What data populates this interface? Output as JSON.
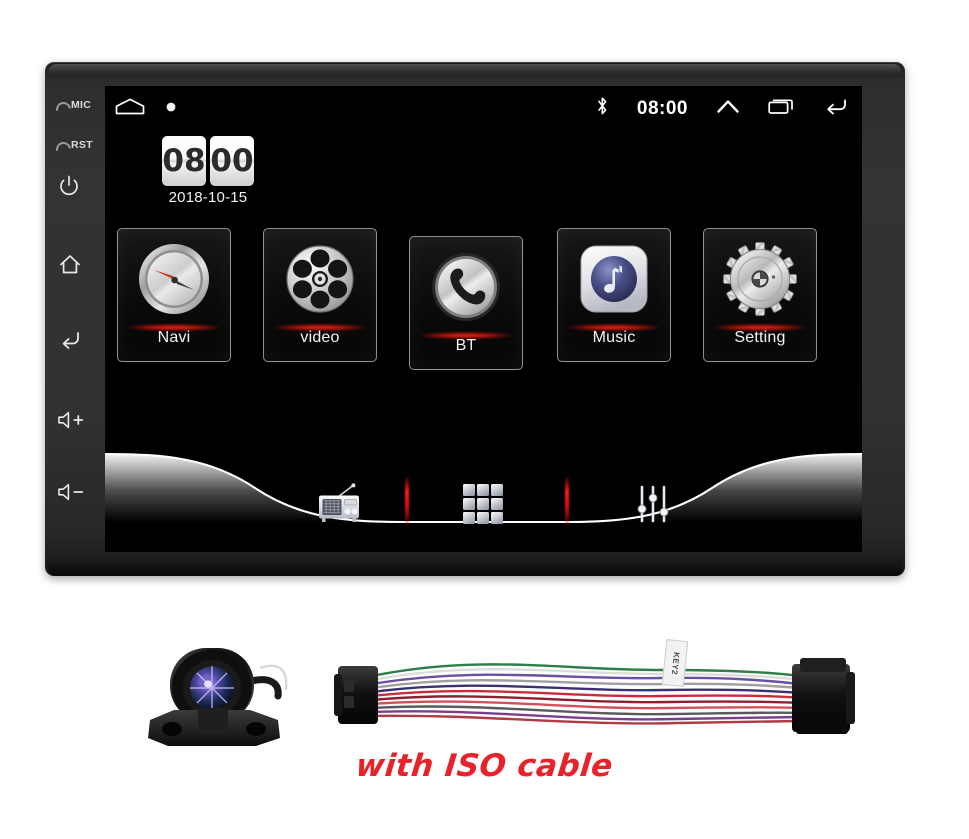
{
  "product": {
    "type": "double-din-android-car-stereo",
    "caption": "with ISO cable",
    "caption_color": "#e8222a"
  },
  "bezel": {
    "indicators": [
      {
        "name": "MIC",
        "label": "MIC"
      },
      {
        "name": "RST",
        "label": "RST"
      }
    ],
    "buttons": [
      {
        "name": "power",
        "icon": "power-icon"
      },
      {
        "name": "home",
        "icon": "home-icon"
      },
      {
        "name": "back",
        "icon": "back-icon"
      },
      {
        "name": "volume-up",
        "icon": "volume-up-icon"
      },
      {
        "name": "volume-down",
        "icon": "volume-down-icon"
      }
    ]
  },
  "statusbar": {
    "home_icon": "home-icon",
    "dot_icon": "dot-indicator-icon",
    "bluetooth_icon": "bluetooth-icon",
    "time": "08:00",
    "chevron_icon": "chevron-up-icon",
    "recents_icon": "recents-icon",
    "back_icon": "back-arrow-icon"
  },
  "clock_widget": {
    "hours": "08",
    "minutes": "00",
    "date": "2018-10-15"
  },
  "apps": [
    {
      "label": "Navi",
      "icon": "compass-icon"
    },
    {
      "label": "video",
      "icon": "film-reel-icon"
    },
    {
      "label": "BT",
      "icon": "phone-handset-icon"
    },
    {
      "label": "Music",
      "icon": "music-note-icon"
    },
    {
      "label": "Setting",
      "icon": "gear-icon"
    }
  ],
  "dock": [
    {
      "name": "radio",
      "icon": "radio-icon"
    },
    {
      "name": "apps",
      "icon": "apps-grid-icon"
    },
    {
      "name": "equalizer",
      "icon": "equalizer-icon"
    }
  ],
  "accessories": [
    {
      "name": "backup-camera",
      "label": ""
    },
    {
      "name": "iso-wiring-harness",
      "tag_text": "KEY2"
    }
  ],
  "colors": {
    "accent_red": "#ff1707",
    "screen_black": "#000000",
    "bezel_grey": "#333333"
  }
}
